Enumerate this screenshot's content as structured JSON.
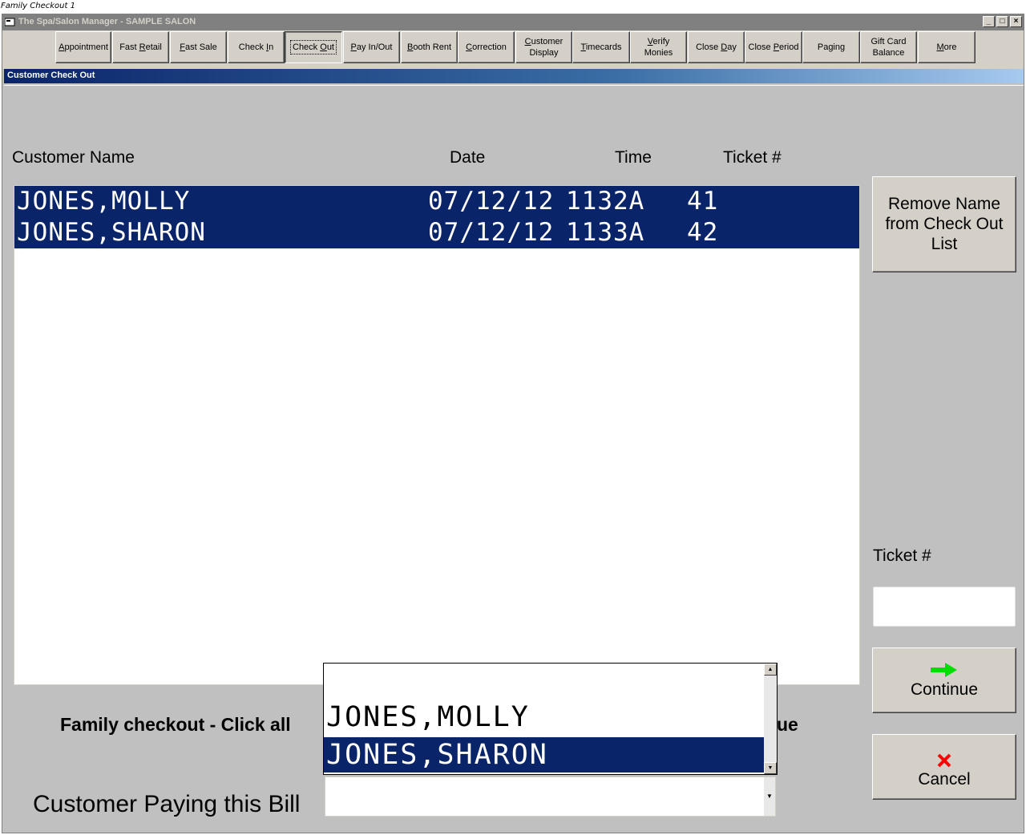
{
  "caption": "Family Checkout 1",
  "window": {
    "title": "The Spa/Salon Manager - SAMPLE SALON"
  },
  "toolbar": [
    {
      "label": "Appointment",
      "accel": "A"
    },
    {
      "label": "Fast Retail",
      "accel": "R"
    },
    {
      "label": "Fast Sale",
      "accel": "F"
    },
    {
      "label": "Check In",
      "accel": "I"
    },
    {
      "label": "Check Out",
      "accel": "O"
    },
    {
      "label": "Pay In/Out",
      "accel": "P"
    },
    {
      "label": "Booth Rent",
      "accel": "B"
    },
    {
      "label": "Correction",
      "accel": "C"
    },
    {
      "label": "Customer Display",
      "accel": "C"
    },
    {
      "label": "Timecards",
      "accel": "T"
    },
    {
      "label": "Verify Monies",
      "accel": "V"
    },
    {
      "label": "Close Day",
      "accel": "D"
    },
    {
      "label": "Close Period",
      "accel": "P"
    },
    {
      "label": "Paging",
      "accel": ""
    },
    {
      "label": "Gift Card Balance",
      "accel": ""
    },
    {
      "label": "More",
      "accel": "M"
    }
  ],
  "section_title": "Customer Check Out",
  "columns": {
    "name": "Customer Name",
    "date": "Date",
    "time": "Time",
    "ticket": "Ticket #"
  },
  "checkout_list": [
    {
      "name": "JONES,MOLLY",
      "date": "07/12/12",
      "time": "1132A",
      "ticket": "41"
    },
    {
      "name": "JONES,SHARON",
      "date": "07/12/12",
      "time": "1133A",
      "ticket": "42"
    }
  ],
  "buttons": {
    "remove": "Remove Name from Check Out List",
    "continue": "Continue",
    "cancel": "Cancel"
  },
  "ticket_label": "Ticket #",
  "ticket_value": "",
  "family_text_start": "Family checkout - Click all",
  "family_text_end": "ue",
  "payer_dropdown": {
    "options": [
      "JONES,MOLLY",
      "JONES,SHARON"
    ],
    "selected": "JONES,SHARON"
  },
  "paying_label": "Customer Paying this Bill",
  "paying_value": "",
  "colors": {
    "selection": "#0a246a",
    "face": "#c0c0c0",
    "continue_arrow": "#00dd00",
    "cancel_x": "#ff0000"
  }
}
